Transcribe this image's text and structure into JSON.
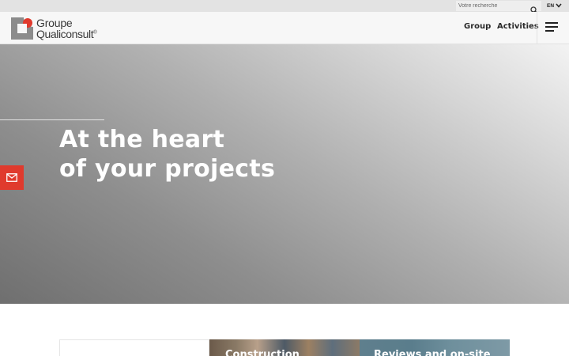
{
  "topbar": {
    "search_placeholder": "Votre recherche",
    "search_icon": "search-icon",
    "language": "EN",
    "language_icon": "chevron-down-icon"
  },
  "header": {
    "logo_line1": "Groupe",
    "logo_line2": "Qualiconsult",
    "logo_trademark": "®",
    "nav": {
      "group": "Group",
      "activities": "Activities"
    },
    "menu_icon": "hamburger-menu-icon"
  },
  "hero": {
    "title_line1": "At the heart",
    "title_line2": "of your projects",
    "contact_icon": "mail-icon"
  },
  "cards": [
    {
      "title": "Construction"
    },
    {
      "title": "Reviews and on-site"
    }
  ],
  "colors": {
    "brand_red": "#e03a2d",
    "logo_gray": "#8c8c8c",
    "text_dark": "#2a2a2a"
  }
}
